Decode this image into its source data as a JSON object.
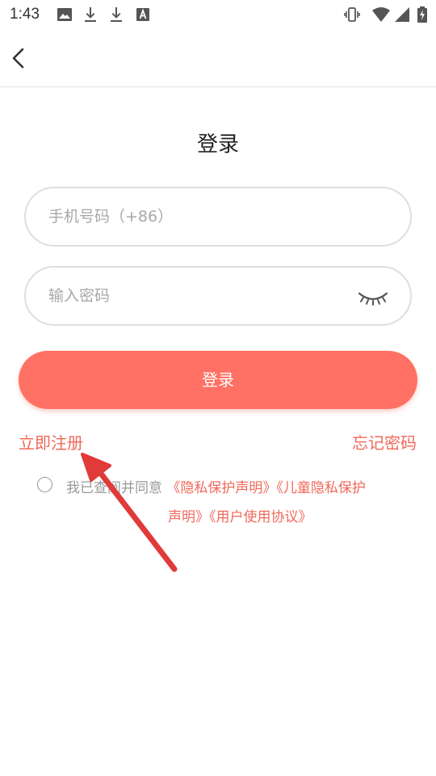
{
  "status_bar": {
    "time": "1:43",
    "left_icons": [
      "image-icon",
      "download-icon",
      "download-icon",
      "font-a-icon"
    ],
    "right_icons": [
      "vibrate-icon",
      "wifi-icon",
      "signal-icon",
      "battery-charging-icon"
    ]
  },
  "header": {
    "back_icon": "chevron-left-icon"
  },
  "page": {
    "title": "登录",
    "phone_placeholder": "手机号码（+86）",
    "password_placeholder": "输入密码",
    "login_button": "登录",
    "register_link": "立即注册",
    "forgot_link": "忘记密码"
  },
  "agreement": {
    "prefix": "我已查阅并同意",
    "privacy_link": "《隐私保护声明》",
    "child_privacy_line1": "《儿童隐私保护",
    "child_privacy_line2": "声明》",
    "user_agreement_link": "《用户使用协议》"
  },
  "colors": {
    "accent": "#ff7164",
    "link": "#f0685a",
    "annotation_arrow": "#e03a3a"
  }
}
